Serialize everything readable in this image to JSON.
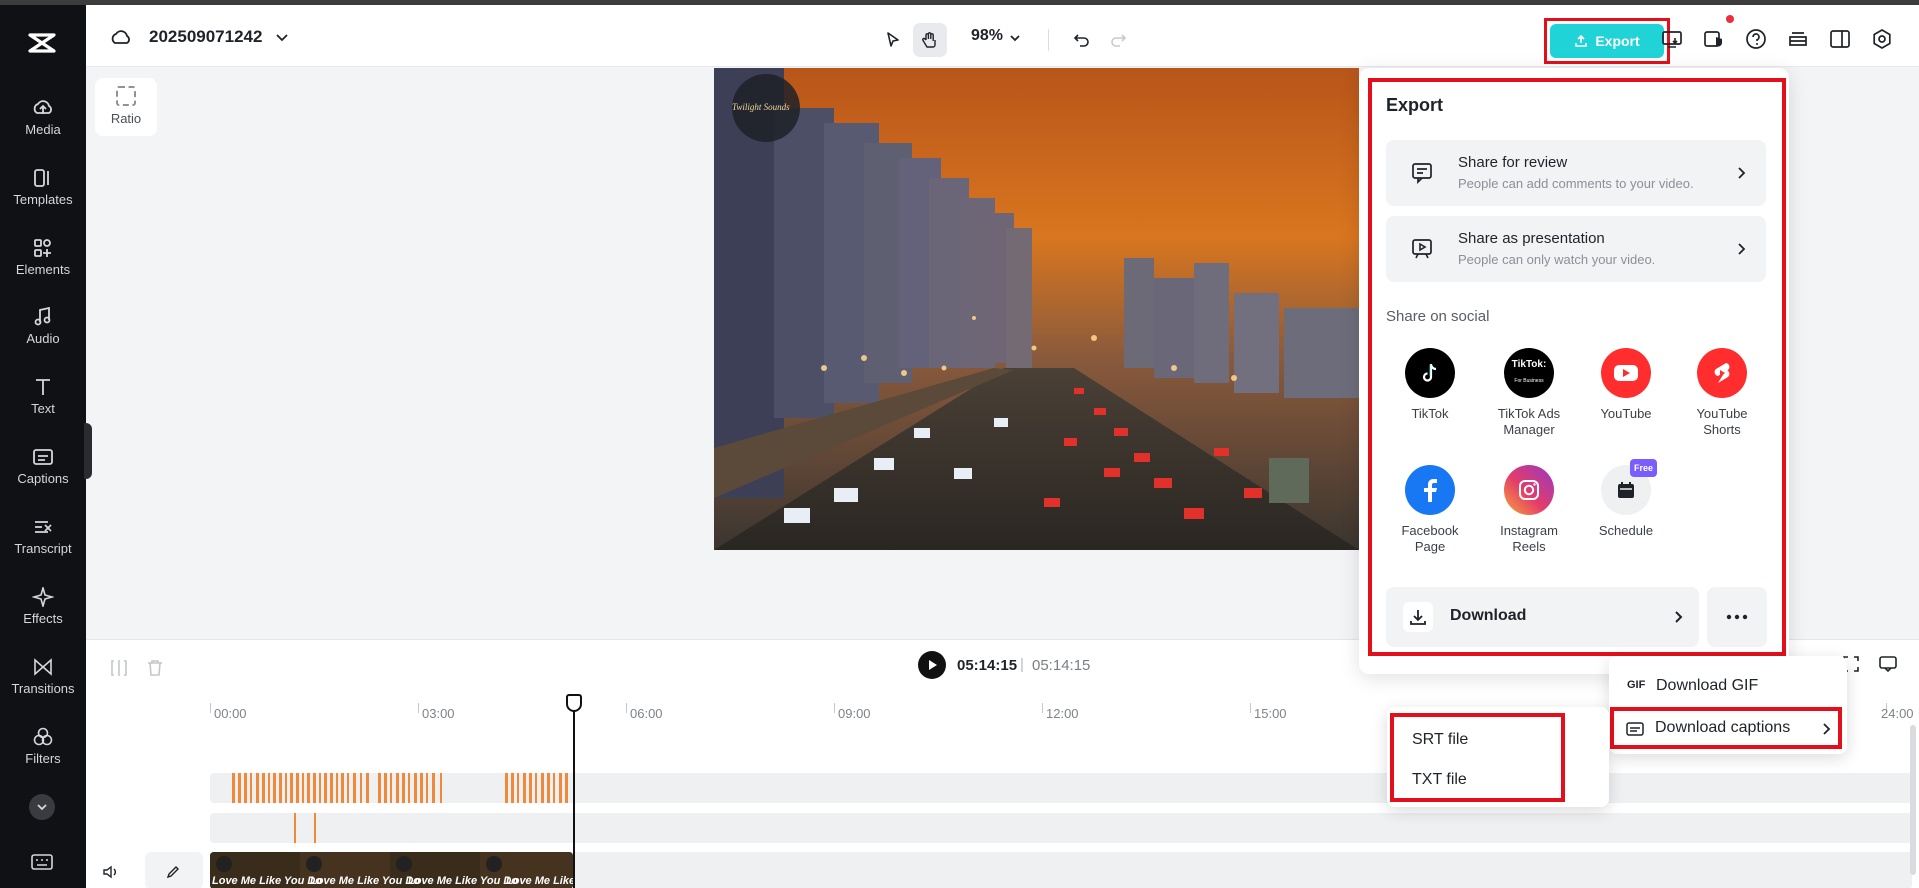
{
  "app": {
    "logo": "capcut-logo-icon"
  },
  "sidebar": {
    "items": [
      {
        "label": "Media",
        "icon": "cloud-upload-icon"
      },
      {
        "label": "Templates",
        "icon": "templates-icon"
      },
      {
        "label": "Elements",
        "icon": "elements-icon"
      },
      {
        "label": "Audio",
        "icon": "music-note-icon"
      },
      {
        "label": "Text",
        "icon": "text-t-icon"
      },
      {
        "label": "Captions",
        "icon": "captions-icon"
      },
      {
        "label": "Transcript",
        "icon": "transcript-icon"
      },
      {
        "label": "Effects",
        "icon": "sparkle-icon"
      },
      {
        "label": "Transitions",
        "icon": "transition-icon"
      },
      {
        "label": "Filters",
        "icon": "filters-icon"
      }
    ]
  },
  "header": {
    "project_name": "202509071242",
    "zoom": "98%",
    "export_label": "Export"
  },
  "canvas": {
    "ratio_label": "Ratio",
    "video_overlay_text": "Twilight Sounds"
  },
  "timeline": {
    "current_time": "05:14:15",
    "separator": "|",
    "total_time": "05:14:15",
    "ruler": [
      "00:00",
      "03:00",
      "06:00",
      "09:00",
      "12:00",
      "15:00",
      "24:00"
    ],
    "clip_label": "Love Me Like You Do"
  },
  "export_panel": {
    "title": "Export",
    "share_review_title": "Share for review",
    "share_review_sub": "People can add comments to your video.",
    "share_present_title": "Share as presentation",
    "share_present_sub": "People can only watch your video.",
    "social_heading": "Share on social",
    "socials": [
      {
        "label": "TikTok",
        "color": "#000000"
      },
      {
        "label": "TikTok Ads Manager",
        "color": "#000000"
      },
      {
        "label": "YouTube",
        "color": "#ff2d2d"
      },
      {
        "label": "YouTube Shorts",
        "color": "#ff2d2d"
      },
      {
        "label": "Facebook Page",
        "color": "#1877f2"
      },
      {
        "label": "Instagram Reels",
        "color": "#d62976"
      },
      {
        "label": "Schedule",
        "color": "#eef0f2",
        "badge": "Free"
      }
    ],
    "tiktok_ads_line1": "TikTok:",
    "tiktok_ads_line2": "For Business",
    "download_label": "Download"
  },
  "download_menu": {
    "gif_tag": "GIF",
    "gif_label": "Download GIF",
    "captions_label": "Download captions"
  },
  "captions_submenu": {
    "srt": "SRT file",
    "txt": "TXT file"
  },
  "colors": {
    "accent": "#1fd3d6",
    "highlight": "#e3101b",
    "sidebar_bg": "#101114"
  }
}
